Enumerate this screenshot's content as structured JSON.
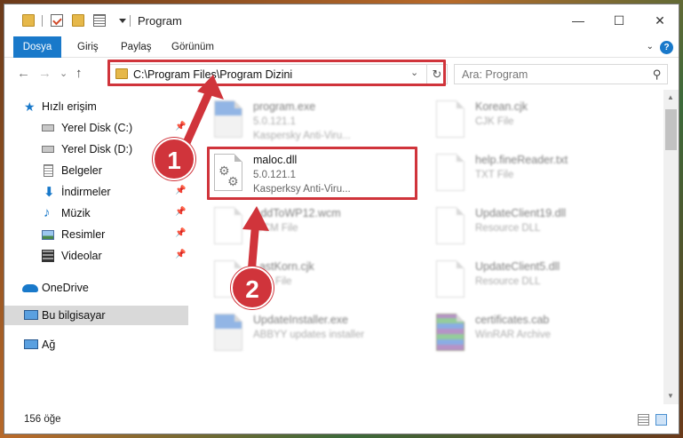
{
  "window": {
    "title": "Program",
    "minimize_glyph": "—",
    "maximize_glyph": "☐",
    "close_glyph": "✕"
  },
  "ribbon": {
    "tabs": [
      {
        "label": "Dosya"
      },
      {
        "label": "Giriş"
      },
      {
        "label": "Paylaş"
      },
      {
        "label": "Görünüm"
      }
    ],
    "help_glyph": "?",
    "collapse_glyph": "⌄"
  },
  "nav": {
    "back_glyph": "←",
    "forward_glyph": "→",
    "recent_glyph": "⌄",
    "up_glyph": "↑",
    "address": "C:\\Program Files\\Program Dizini",
    "address_dropdown_glyph": "⌄",
    "refresh_glyph": "↻",
    "search_placeholder": "Ara: Program",
    "search_glyph": "⚲"
  },
  "sidebar": {
    "items": [
      {
        "label": "Hızlı erişim",
        "icon": "star-icon"
      },
      {
        "label": "Yerel Disk (C:)",
        "icon": "drive-icon",
        "pinned": true
      },
      {
        "label": "Yerel Disk (D:)",
        "icon": "drive-icon",
        "pinned": true
      },
      {
        "label": "Belgeler",
        "icon": "documents-icon",
        "pinned": true
      },
      {
        "label": "İndirmeler",
        "icon": "download-icon",
        "pinned": true
      },
      {
        "label": "Müzik",
        "icon": "music-icon",
        "pinned": true
      },
      {
        "label": "Resimler",
        "icon": "pictures-icon",
        "pinned": true
      },
      {
        "label": "Videolar",
        "icon": "videos-icon",
        "pinned": true
      },
      {
        "label": "OneDrive",
        "icon": "onedrive-icon"
      },
      {
        "label": "Bu bilgisayar",
        "icon": "computer-icon",
        "selected": true
      },
      {
        "label": "Ağ",
        "icon": "network-icon"
      }
    ],
    "pin_glyph": "📌"
  },
  "files": [
    {
      "name": "program.exe",
      "line2": "5.0.121.1",
      "line3": "Kaspersky Anti-Viru...",
      "icon": "exe",
      "blurred": true
    },
    {
      "name": "Korean.cjk",
      "line2": "CJK File",
      "line3": "",
      "icon": "doc",
      "blurred": true
    },
    {
      "name": "maloc.dll",
      "line2": "5.0.121.1",
      "line3": "Kasperksy Anti-Viru...",
      "icon": "dll",
      "blurred": false
    },
    {
      "name": "help.fineReader.txt",
      "line2": "TXT File",
      "line3": "",
      "icon": "doc",
      "blurred": true
    },
    {
      "name": "AddToWP12.wcm",
      "line2": "WCM File",
      "line3": "",
      "icon": "doc",
      "blurred": true
    },
    {
      "name": "UpdateClient19.dll",
      "line2": "Resource DLL",
      "line3": "",
      "icon": "dll",
      "blurred": true
    },
    {
      "name": "LastKorn.cjk",
      "line2": "CJK File",
      "line3": "",
      "icon": "doc",
      "blurred": true
    },
    {
      "name": "UpdateClient5.dll",
      "line2": "Resource DLL",
      "line3": "",
      "icon": "dll",
      "blurred": true
    },
    {
      "name": "UpdateInstaller.exe",
      "line2": "ABBYY updates installer",
      "line3": "",
      "icon": "exe",
      "blurred": true
    },
    {
      "name": "certificates.cab",
      "line2": "WinRAR Archive",
      "line3": "",
      "icon": "rar",
      "blurred": true
    }
  ],
  "status": {
    "item_count": "156 öğe"
  },
  "annotations": {
    "badge1": "1",
    "badge2": "2"
  },
  "colors": {
    "accent": "#1979ca",
    "highlight_red": "#d0343b",
    "selected_bg": "#d9d9d9"
  }
}
